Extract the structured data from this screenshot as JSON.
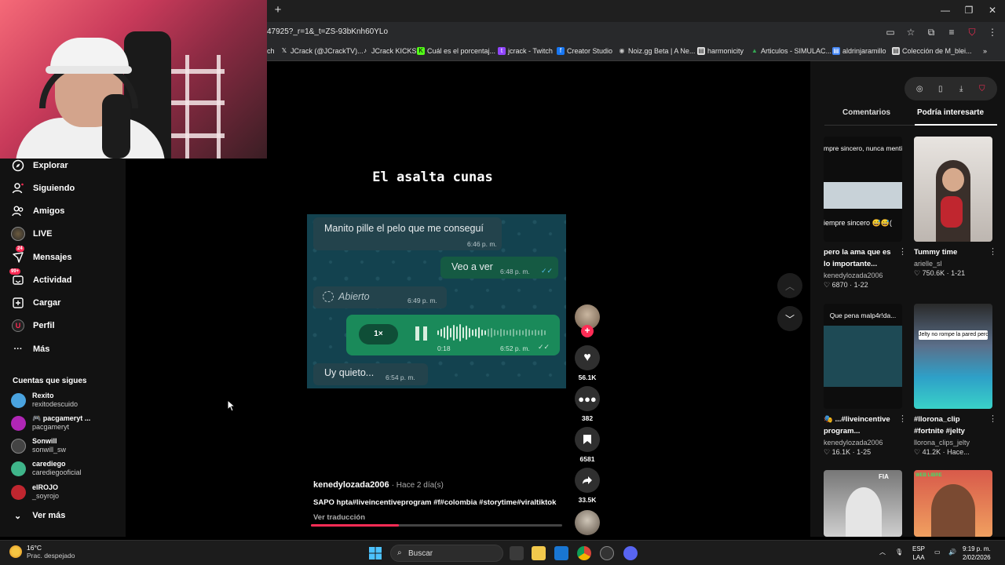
{
  "browser": {
    "url": "47925?_r=1&_t=ZS-93bKnh60YLo",
    "bookmarks": [
      {
        "label": "ch",
        "icon": "tab-icon",
        "color": "#888888"
      },
      {
        "label": "JCrack (@JCrackTV)...",
        "icon": "x-icon",
        "color": "#ffffff"
      },
      {
        "label": "JCrack KICKS",
        "icon": "tiktok-icon",
        "color": "#ffffff"
      },
      {
        "label": "Cuál es el porcentaj...",
        "icon": "kick-icon",
        "color": "#53fc18"
      },
      {
        "label": "jcrack - Twitch",
        "icon": "twitch-icon",
        "color": "#9146ff"
      },
      {
        "label": "Creator Studio",
        "icon": "facebook-icon",
        "color": "#1877f2"
      },
      {
        "label": "Noiz.gg Beta | A Ne...",
        "icon": "noiz-icon",
        "color": "#cccccc"
      },
      {
        "label": "harmonicity",
        "icon": "doc-icon",
        "color": "#dddddd"
      },
      {
        "label": "Articulos - SIMULAC...",
        "icon": "drive-icon",
        "color": "#34a853"
      },
      {
        "label": "aldrinjaramillo",
        "icon": "page-icon",
        "color": "#4285f4"
      },
      {
        "label": "Colección de M_blei...",
        "icon": "page-icon",
        "color": "#dddddd"
      }
    ]
  },
  "nav": {
    "items": [
      {
        "label": "Explorar",
        "icon": "compass-icon"
      },
      {
        "label": "Siguiendo",
        "icon": "following-icon"
      },
      {
        "label": "Amigos",
        "icon": "friends-icon"
      },
      {
        "label": "LIVE",
        "icon": "live-icon"
      },
      {
        "label": "Mensajes",
        "icon": "messages-icon",
        "badge": "24"
      },
      {
        "label": "Actividad",
        "icon": "activity-icon",
        "badge": "99+"
      },
      {
        "label": "Cargar",
        "icon": "upload-icon"
      },
      {
        "label": "Perfil",
        "icon": "profile-icon"
      },
      {
        "label": "Más",
        "icon": "more-icon"
      }
    ],
    "follows_title": "Cuentas que sigues",
    "follows": [
      {
        "name": "Rexito",
        "handle": "rexitodescuido",
        "color": "#4aa3df"
      },
      {
        "name": "🎮 pacgameryt ...",
        "handle": "pacgameryt",
        "color": "#b026b5"
      },
      {
        "name": "Sonwill",
        "handle": "sonwill_sw",
        "color": "#444444"
      },
      {
        "name": "carediego",
        "handle": "carediegooficial",
        "color": "#3fb58a"
      },
      {
        "name": "elROJO",
        "handle": "_soyrojo",
        "color": "#c0262f"
      }
    ],
    "see_more": "Ver más"
  },
  "video": {
    "title": "El asalta cunas",
    "messages": {
      "m1": "Manito pille el pelo que me conseguí",
      "t1": "6:46 p. m.",
      "m2": "Veo a ver",
      "t2": "6:48 p. m.",
      "m3": "Abierto",
      "t3": "6:49 p. m.",
      "speed": "1×",
      "dur": "0:18",
      "t4": "6:52 p. m.",
      "m5": "Uy quieto...",
      "t5": "6:54 p. m."
    },
    "author": "kenedylozada2006",
    "posted": "· Hace 2 día(s)",
    "caption": "SAPO hpta#liveincentiveprogram #f#colombia #storytime#viraltiktok",
    "translate": "Ver traducción",
    "progress": 0.35,
    "likes": "56.1K",
    "comments": "382",
    "saves": "6581",
    "shares": "33.5K"
  },
  "right": {
    "tab_comments": "Comentarios",
    "tab_interest": "Podría interesarte",
    "cards": [
      {
        "overlay_top": "mpre sincero, nunca mentir",
        "overlay_bottom": "iempre sincero 😅😅(",
        "title": "pero la ama que es lo importante...",
        "user": "kenedylozada2006",
        "stats": "♡ 6870 · 1-22"
      },
      {
        "title": "Tummy time",
        "user": "arielle_sl",
        "stats": "♡ 750.6K · 1-21"
      },
      {
        "overlay_top": "Que pena malp4r!da...",
        "title": "🎭 ...#liveincentive program...",
        "user": "kenedylozada2006",
        "stats": "♡ 16.1K · 1-25"
      },
      {
        "overlay_top": "Jelty no rompe la pared pero...",
        "title": "#llorona_clip #fortnite #jelty",
        "user": "llorona_clips_jelty",
        "stats": "♡ 41.2K · Hace..."
      },
      {
        "overlay_top": "FIA",
        "title": "",
        "user": "",
        "stats": ""
      },
      {
        "overlay_top": "WEB LIBRE",
        "title": "",
        "user": "",
        "stats": ""
      }
    ]
  },
  "taskbar": {
    "temp": "16°C",
    "weather": "Prac. despejado",
    "search_placeholder": "Buscar",
    "lang1": "ESP",
    "lang2": "LAA",
    "time": "9:19 p. m.",
    "date": "2/02/2026"
  }
}
